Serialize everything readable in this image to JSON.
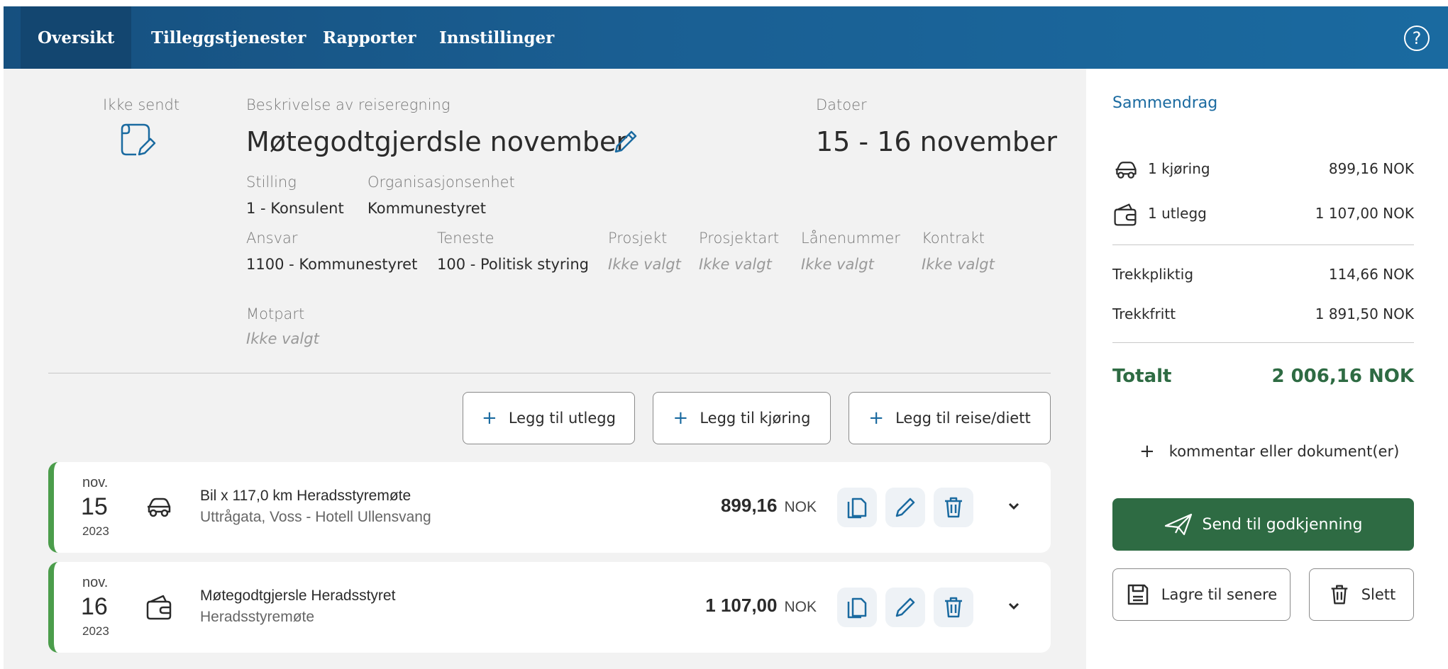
{
  "nav": {
    "tabs": [
      {
        "label": "Oversikt",
        "active": true
      },
      {
        "label": "Tilleggstjenester",
        "active": false
      },
      {
        "label": "Rapporter",
        "active": false
      },
      {
        "label": "Innstillinger",
        "active": false
      }
    ],
    "help_icon": "question-circle-icon"
  },
  "status": {
    "label": "Ikke sendt",
    "icon": "document-edit-icon"
  },
  "report": {
    "description_label": "Beskrivelse av reiseregning",
    "title": "Møtegodtgjerdsle november",
    "dates_label": "Datoer",
    "dates": "15 - 16 november",
    "fields_row1": [
      {
        "label": "Stilling",
        "value": "1 - Konsulent"
      },
      {
        "label": "Organisasjonsenhet",
        "value": "Kommunestyret"
      }
    ],
    "fields_row2": [
      {
        "label": "Ansvar",
        "value": "1100 - Kommunestyret"
      },
      {
        "label": "Teneste",
        "value": "100 - Politisk styring"
      },
      {
        "label": "Prosjekt",
        "value": "Ikke valgt"
      },
      {
        "label": "Prosjektart",
        "value": "Ikke valgt"
      },
      {
        "label": "Lånenummer",
        "value": "Ikke valgt"
      },
      {
        "label": "Kontrakt",
        "value": "Ikke valgt"
      }
    ],
    "motpart": {
      "label": "Motpart",
      "value": "Ikke valgt"
    }
  },
  "add_buttons": {
    "utlegg": "Legg til utlegg",
    "kjoring": "Legg til kjøring",
    "reise": "Legg til reise/diett"
  },
  "entries": [
    {
      "month": "nov.",
      "day": "15",
      "year": "2023",
      "icon": "car-icon",
      "title": "Bil x 117,0 km Heradsstyremøte",
      "subtitle": "Uttrågata, Voss - Hotell Ullensvang",
      "amount": "899,16",
      "currency": "NOK"
    },
    {
      "month": "nov.",
      "day": "16",
      "year": "2023",
      "icon": "wallet-icon",
      "title": "Møtegodtgjersle Heradsstyret",
      "subtitle": "Heradsstyremøte",
      "amount": "1 107,00",
      "currency": "NOK"
    }
  ],
  "summary": {
    "heading": "Sammendrag",
    "kjoring": {
      "label": "1 kjøring",
      "amount": "899,16 NOK"
    },
    "utlegg": {
      "label": "1 utlegg",
      "amount": "1 107,00 NOK"
    },
    "trekkpliktig": {
      "label": "Trekkpliktig",
      "amount": "114,66 NOK"
    },
    "trekkfritt": {
      "label": "Trekkfritt",
      "amount": "1 891,50 NOK"
    },
    "total": {
      "label": "Totalt",
      "amount": "2 006,16 NOK"
    },
    "comment": "kommentar eller dokument(er)",
    "send": "Send til godkjenning",
    "save": "Lagre til senere",
    "delete": "Slett"
  },
  "colors": {
    "nav": "#1a5f93",
    "accent": "#1a6aa0",
    "send": "#2e6b43",
    "row_stripe": "#4b9d4b"
  }
}
